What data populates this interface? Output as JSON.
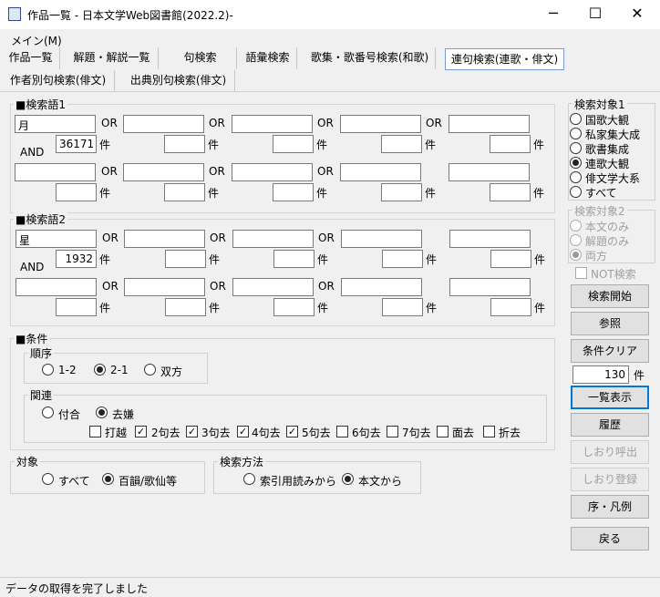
{
  "window": {
    "title": "作品一覧 - 日本文学Web図書館(2022.2)-",
    "minimize": "─",
    "maximize": "☐",
    "close": "✕"
  },
  "menu": {
    "main": "メイン(M)"
  },
  "tabs_row1": [
    "作品一覧",
    "解題・解説一覧",
    "句検索",
    "語彙検索",
    "歌集・歌番号検索(和歌)",
    "連句検索(連歌・俳文)"
  ],
  "tabs_row2": [
    "作者別句検索(俳文)",
    "出典別句検索(俳文)"
  ],
  "search1": {
    "title": "■検索語1",
    "row1_terms": [
      "月",
      "",
      "",
      "",
      ""
    ],
    "row1_counts": [
      "36171",
      "",
      "",
      "",
      ""
    ],
    "row2_terms": [
      "",
      "",
      "",
      "",
      ""
    ],
    "row2_counts": [
      "",
      "",
      "",
      "",
      ""
    ]
  },
  "search2": {
    "title": "■検索語2",
    "row1_terms": [
      "星",
      "",
      "",
      "",
      ""
    ],
    "row1_counts": [
      "1932",
      "",
      "",
      "",
      ""
    ],
    "row2_terms": [
      "",
      "",
      "",
      "",
      ""
    ],
    "row2_counts": [
      "",
      "",
      "",
      "",
      ""
    ]
  },
  "labels": {
    "or": "OR",
    "and": "AND",
    "ken": "件"
  },
  "conditions": {
    "title": "■条件",
    "order_caption": "順序",
    "order_options": [
      {
        "label": "1-2",
        "selected": false
      },
      {
        "label": "2-1",
        "selected": true
      },
      {
        "label": "双方",
        "selected": false
      }
    ],
    "relation_caption": "関連",
    "relation_options": [
      {
        "label": "付合",
        "selected": false
      },
      {
        "label": "去嫌",
        "selected": true
      }
    ],
    "distance_checks": [
      {
        "label": "打越",
        "checked": false
      },
      {
        "label": "2句去",
        "checked": true
      },
      {
        "label": "3句去",
        "checked": true
      },
      {
        "label": "4句去",
        "checked": true
      },
      {
        "label": "5句去",
        "checked": true
      },
      {
        "label": "6句去",
        "checked": false
      },
      {
        "label": "7句去",
        "checked": false
      },
      {
        "label": "面去",
        "checked": false
      },
      {
        "label": "折去",
        "checked": false
      }
    ]
  },
  "target": {
    "caption": "対象",
    "options": [
      {
        "label": "すべて",
        "selected": false
      },
      {
        "label": "百韻/歌仙等",
        "selected": true
      }
    ]
  },
  "method": {
    "caption": "検索方法",
    "options": [
      {
        "label": "索引用読みから",
        "selected": false
      },
      {
        "label": "本文から",
        "selected": true
      }
    ]
  },
  "scope1": {
    "caption": "検索対象1",
    "options": [
      {
        "label": "国歌大観",
        "selected": false
      },
      {
        "label": "私家集大成",
        "selected": false
      },
      {
        "label": "歌書集成",
        "selected": false
      },
      {
        "label": "連歌大観",
        "selected": true
      },
      {
        "label": "俳文学大系",
        "selected": false
      },
      {
        "label": "すべて",
        "selected": false
      }
    ]
  },
  "scope2": {
    "caption": "検索対象2",
    "options": [
      {
        "label": "本文のみ",
        "selected": false
      },
      {
        "label": "解題のみ",
        "selected": false
      },
      {
        "label": "両方",
        "selected": true
      }
    ]
  },
  "not_search": {
    "label": "NOT検索",
    "checked": false
  },
  "buttons": {
    "search": "検索開始",
    "reference": "参照",
    "clear": "条件クリア",
    "list": "一覧表示",
    "history": "履歴",
    "bookmark_load": "しおり呼出",
    "bookmark_save": "しおり登録",
    "preface": "序・凡例",
    "back": "戻る"
  },
  "list_count": "130",
  "status": "データの取得を完了しました"
}
